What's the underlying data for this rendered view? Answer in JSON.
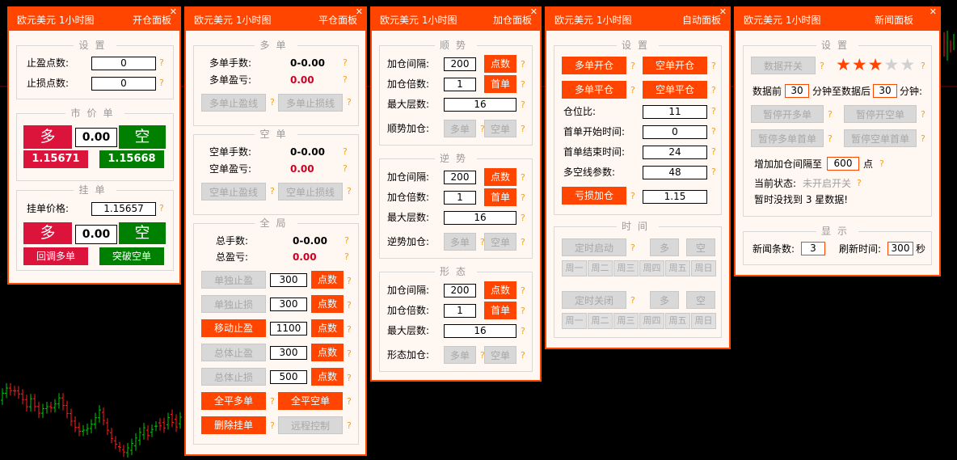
{
  "p1": {
    "title": "欧元美元 1小时图",
    "name": "开仓面板",
    "settings_title": "设置",
    "tp_label": "止盈点数:",
    "tp_value": "0",
    "sl_label": "止损点数:",
    "sl_value": "0",
    "market_title": "市价单",
    "buy": "多",
    "sell": "空",
    "lots": "0.00",
    "bid": "1.15671",
    "ask": "1.15668",
    "pending_title": "挂单",
    "pending_label": "挂单价格:",
    "pending_value": "1.15657",
    "pbuy": "多",
    "psell": "空",
    "plots": "0.00",
    "pullback_buy": "回调多单",
    "breakout_sell": "突破空单"
  },
  "p2": {
    "title": "欧元美元 1小时图",
    "name": "平仓面板",
    "long_title": "多单",
    "long_lots_label": "多单手数:",
    "long_lots": "0-0.00",
    "long_pl_label": "多单盈亏:",
    "long_pl": "0.00",
    "long_tp": "多单止盈线",
    "long_sl": "多单止损线",
    "short_title": "空单",
    "short_lots_label": "空单手数:",
    "short_lots": "0-0.00",
    "short_pl_label": "空单盈亏:",
    "short_pl": "0.00",
    "short_tp": "空单止盈线",
    "short_sl": "空单止损线",
    "global_title": "全局",
    "total_lots_label": "总手数:",
    "total_lots": "0-0.00",
    "total_pl_label": "总盈亏:",
    "total_pl": "0.00",
    "rows": [
      {
        "label": "单独止盈",
        "value": "300",
        "unit": "点数"
      },
      {
        "label": "单独止损",
        "value": "300",
        "unit": "点数"
      },
      {
        "label": "移动止盈",
        "value": "1100",
        "unit": "点数"
      },
      {
        "label": "总体止盈",
        "value": "300",
        "unit": "点数"
      },
      {
        "label": "总体止损",
        "value": "500",
        "unit": "点数"
      }
    ],
    "close_long": "全平多单",
    "close_short": "全平空单",
    "delete_pending": "删除挂单",
    "remote": "远程控制"
  },
  "p3": {
    "title": "欧元美元 1小时图",
    "name": "加仓面板",
    "sections": [
      {
        "title": "顺势",
        "gap_label": "加仓间隔:",
        "gap": "200",
        "gap_unit": "点数",
        "mult_label": "加仓倍数:",
        "mult": "1",
        "mult_unit": "首单",
        "max_label": "最大层数:",
        "max": "16",
        "add_label": "顺势加仓:",
        "buy": "多单",
        "sell": "空单"
      },
      {
        "title": "逆势",
        "gap_label": "加仓间隔:",
        "gap": "200",
        "gap_unit": "点数",
        "mult_label": "加仓倍数:",
        "mult": "1",
        "mult_unit": "首单",
        "max_label": "最大层数:",
        "max": "16",
        "add_label": "逆势加仓:",
        "buy": "多单",
        "sell": "空单"
      },
      {
        "title": "形态",
        "gap_label": "加仓间隔:",
        "gap": "200",
        "gap_unit": "点数",
        "mult_label": "加仓倍数:",
        "mult": "1",
        "mult_unit": "首单",
        "max_label": "最大层数:",
        "max": "16",
        "add_label": "形态加仓:",
        "buy": "多单",
        "sell": "空单"
      }
    ]
  },
  "p4": {
    "title": "欧元美元 1小时图",
    "name": "自动面板",
    "settings_title": "设置",
    "open_long": "多单开仓",
    "open_short": "空单开仓",
    "close_long": "多单平仓",
    "close_short": "空单平仓",
    "ratio_label": "仓位比:",
    "ratio": "11",
    "start_label": "首单开始时间:",
    "start": "0",
    "end_label": "首单结束时间:",
    "end": "24",
    "param_label": "多空线参数:",
    "param": "48",
    "loss_add": "亏损加仓",
    "loss_value": "1.15",
    "time_title": "时间",
    "timed_open": "定时启动",
    "timed_close": "定时关闭",
    "buy": "多",
    "sell": "空",
    "days": [
      "周一",
      "周二",
      "周三",
      "周四",
      "周五",
      "周日"
    ]
  },
  "p5": {
    "title": "欧元美元 1小时图",
    "name": "新闻面板",
    "settings_title": "设置",
    "data_switch": "数据开关",
    "stars_filled": 3,
    "stars_total": 5,
    "before_label": "数据前",
    "before": "30",
    "mid_label": "分钟至数据后",
    "after": "30",
    "after_label": "分钟:",
    "pause_open_long": "暂停开多单",
    "pause_open_short": "暂停开空单",
    "pause_first_long": "暂停多单首单",
    "pause_first_short": "暂停空单首单",
    "gap_label": "增加加仓间隔至",
    "gap": "600",
    "gap_unit": "点",
    "status_label": "当前状态:",
    "status": "未开启开关",
    "notfound": "暂时没找到 3 星数据!",
    "display_title": "显示",
    "count_label": "新闻条数:",
    "count": "3",
    "refresh_label": "刷新时间:",
    "refresh": "300",
    "refresh_unit": "秒"
  },
  "colors": {
    "accent": "#ff4500",
    "buy": "#dc143c",
    "sell": "#008000",
    "up_candle": "#00cc00",
    "down_candle": "#ff2020",
    "help": "#f0a020"
  },
  "icons": {
    "close": "close-icon",
    "help": "help-icon",
    "star": "star-icon"
  }
}
